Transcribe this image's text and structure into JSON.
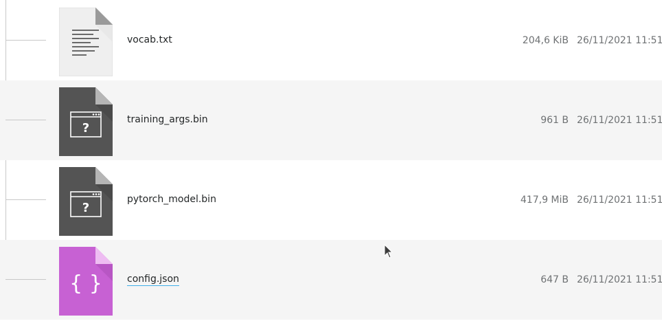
{
  "files": [
    {
      "name": "vocab.txt",
      "size": "204,6 KiB",
      "modified": "26/11/2021 11:51",
      "icon": "text-file-icon",
      "color": "#ececec"
    },
    {
      "name": "training_args.bin",
      "size": "961 B",
      "modified": "26/11/2021 11:51",
      "icon": "unknown-binary-file-icon",
      "color": "#545454"
    },
    {
      "name": "pytorch_model.bin",
      "size": "417,9 MiB",
      "modified": "26/11/2021 11:51",
      "icon": "unknown-binary-file-icon",
      "color": "#545454"
    },
    {
      "name": "config.json",
      "size": "647 B",
      "modified": "26/11/2021 11:51",
      "icon": "json-file-icon",
      "color": "#c761d3"
    }
  ]
}
